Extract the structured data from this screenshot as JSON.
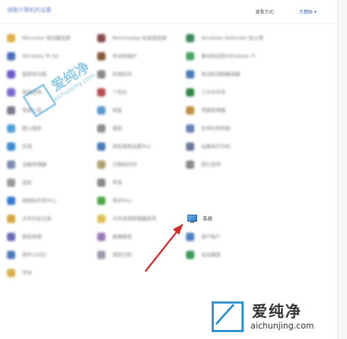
{
  "header": {
    "title": "调整计算机的设置",
    "view_by_label": "查看方式:",
    "view_by_value": "大图标"
  },
  "items": [
    {
      "label": "BitLocker 驱动器加密",
      "icon_color": "#e0b04a"
    },
    {
      "label": "RemoteApp 和桌面连接",
      "icon_color": "#8a4a4a"
    },
    {
      "label": "Windows Defender 防火墙",
      "icon_color": "#3a8a5a"
    },
    {
      "label": "Windows To Go",
      "icon_color": "#4b6fb8"
    },
    {
      "label": "安全和维护",
      "icon_color": "#8a5a3a"
    },
    {
      "label": "备份和还原(Windows 7)",
      "icon_color": "#4aa46a"
    },
    {
      "label": "程序和功能",
      "icon_color": "#6a5ac8"
    },
    {
      "label": "存储空间",
      "icon_color": "#8a8a8a"
    },
    {
      "label": "电话和调制解调器",
      "icon_color": "#4a7ab8"
    },
    {
      "label": "电源选项",
      "icon_color": "#7a6ad0"
    },
    {
      "label": "个性化",
      "icon_color": "#b85050"
    },
    {
      "label": "工作文件夹",
      "icon_color": "#2f8a4a"
    },
    {
      "label": "管理工具",
      "icon_color": "#7a7a8a"
    },
    {
      "label": "恢复",
      "icon_color": "#5a9ad0"
    },
    {
      "label": "键盘",
      "icon_color": "#909090"
    },
    {
      "label": "默认程序",
      "icon_color": "#4fa0d8"
    },
    {
      "label": "凭据管理器",
      "icon_color": "#c09040"
    },
    {
      "label": "轻松使用设置中心",
      "icon_color": "#4a7ab8"
    },
    {
      "label": "区域",
      "icon_color": "#3a8ad0"
    },
    {
      "label": "任务栏和导航",
      "icon_color": "#6a80b8"
    },
    {
      "label": "日期和时间",
      "icon_color": "#b0a070"
    },
    {
      "label": "设备管理器",
      "icon_color": "#7a8ab0"
    },
    {
      "label": "设备和打印机",
      "icon_color": "#6a7a9a"
    },
    {
      "label": "声音",
      "icon_color": "#8a8a8a"
    },
    {
      "label": "鼠标",
      "icon_color": "#9a9a9a"
    },
    {
      "label": "索引选项",
      "icon_color": "#8a8a8a"
    },
    {
      "label": "同步中心",
      "icon_color": "#4fa84a"
    },
    {
      "label": "网络和共享中心",
      "icon_color": "#3a7ad0"
    },
    {
      "label": "文件历史记录",
      "icon_color": "#d4a63a"
    },
    {
      "label": "文件资源管理器选项",
      "icon_color": "#e0c050"
    },
    {
      "label": "系统",
      "icon_color": "#2a78c8"
    },
    {
      "label": "颜色管理",
      "icon_color": "#6a6ab8"
    },
    {
      "label": "疑难解答",
      "icon_color": "#9a7ab8"
    },
    {
      "label": "用户帐户",
      "icon_color": "#4a80c0"
    },
    {
      "label": "邮件(32位)",
      "icon_color": "#4a7ab8"
    },
    {
      "label": "语音识别",
      "icon_color": "#9a9ab0"
    },
    {
      "label": "自动播放",
      "icon_color": "#3a9a5a"
    },
    {
      "label": "字体",
      "icon_color": "#d8b048"
    }
  ],
  "watermark": {
    "brand_cn": "爱纯净",
    "brand_url": "aichunjing.com"
  },
  "colors": {
    "arrow": "#d42a2a"
  }
}
